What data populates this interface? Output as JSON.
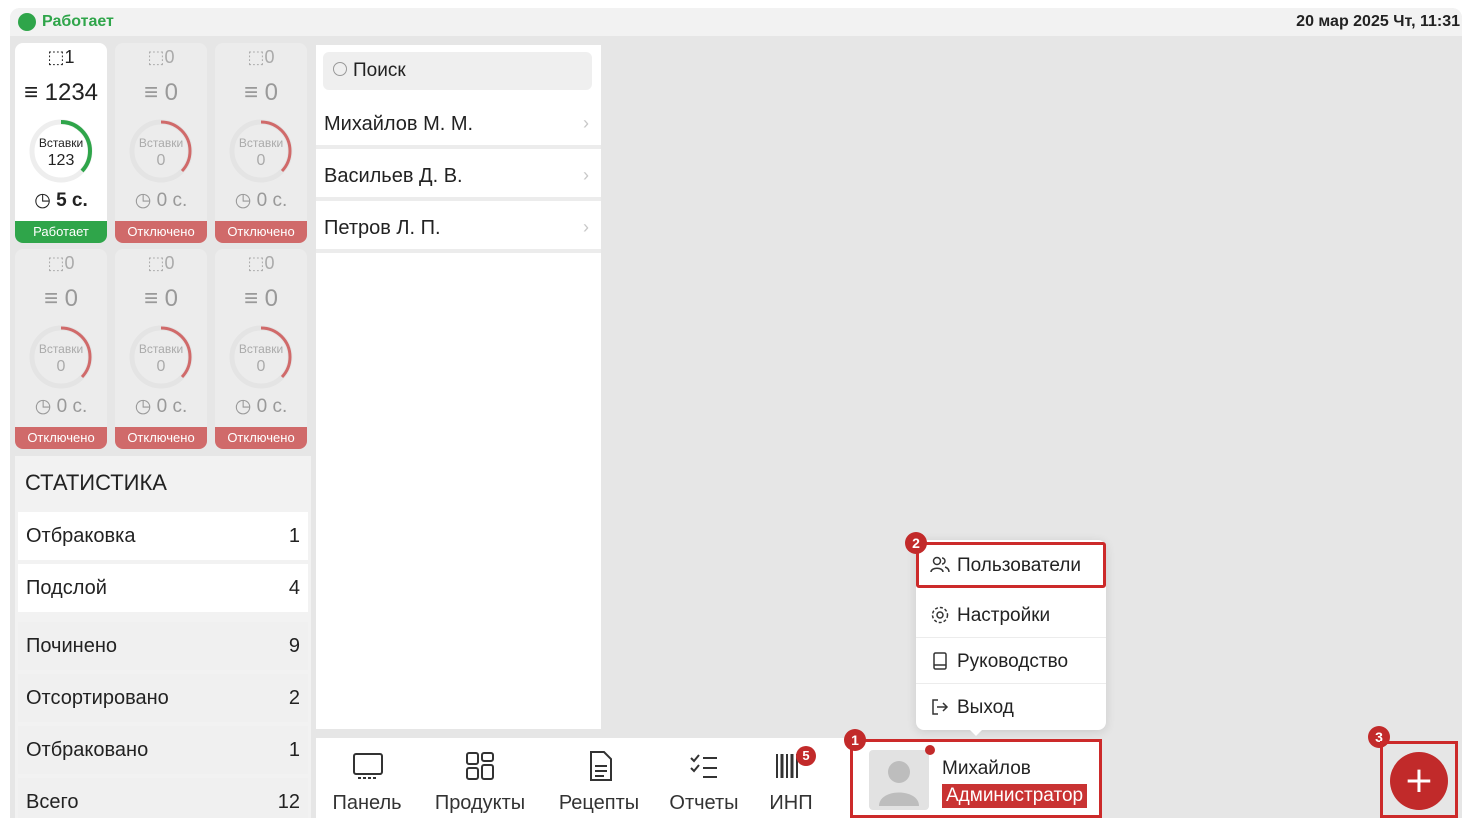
{
  "status": {
    "text": "Работает",
    "datetime": "20 мар 2025 Чт, 11:31",
    "color": "#2fa54a"
  },
  "stations": [
    {
      "top_count": "1",
      "layers": "1234",
      "inserts_label": "Вставки",
      "inserts": "123",
      "time": "5 с.",
      "state": "Работает",
      "progress": 0.35
    },
    {
      "top_count": "0",
      "layers": "0",
      "inserts_label": "Вставки",
      "inserts": "0",
      "time": "0 с.",
      "state": "Отключено",
      "progress": 0.35
    },
    {
      "top_count": "0",
      "layers": "0",
      "inserts_label": "Вставки",
      "inserts": "0",
      "time": "0 с.",
      "state": "Отключено",
      "progress": 0.35
    },
    {
      "top_count": "0",
      "layers": "0",
      "inserts_label": "Вставки",
      "inserts": "0",
      "time": "0 с.",
      "state": "Отключено",
      "progress": 0.35
    },
    {
      "top_count": "0",
      "layers": "0",
      "inserts_label": "Вставки",
      "inserts": "0",
      "time": "0 с.",
      "state": "Отключено",
      "progress": 0.35
    },
    {
      "top_count": "0",
      "layers": "0",
      "inserts_label": "Вставки",
      "inserts": "0",
      "time": "0 с.",
      "state": "Отключено",
      "progress": 0.35
    }
  ],
  "stats": {
    "title": "СТАТИСТИКА",
    "rows": [
      {
        "label": "Отбраковка",
        "value": "1"
      },
      {
        "label": "Подслой",
        "value": "4"
      },
      {
        "label": "Починено",
        "value": "9"
      },
      {
        "label": "Отсортировано",
        "value": "2"
      },
      {
        "label": "Отбраковано",
        "value": "1"
      },
      {
        "label": "Всего",
        "value": "12"
      }
    ]
  },
  "users": {
    "search_placeholder": "Поиск",
    "items": [
      "Михайлов М. М.",
      "Васильев Д. В.",
      "Петров Л. П."
    ]
  },
  "nav": {
    "items": [
      {
        "label": "Панель",
        "icon": "monitor-icon"
      },
      {
        "label": "Продукты",
        "icon": "grid-icon"
      },
      {
        "label": "Рецепты",
        "icon": "document-icon"
      },
      {
        "label": "Отчеты",
        "icon": "checklist-icon"
      },
      {
        "label": "ИНП",
        "icon": "barcode-icon",
        "badge": "5"
      }
    ]
  },
  "menu": {
    "items": [
      {
        "label": "Пользователи",
        "icon": "users-icon"
      },
      {
        "label": "Настройки",
        "icon": "gear-icon"
      },
      {
        "label": "Руководство",
        "icon": "book-icon"
      },
      {
        "label": "Выход",
        "icon": "logout-icon"
      }
    ]
  },
  "profile": {
    "name": "Михайлов",
    "role": "Администратор"
  },
  "steps": {
    "one": "1",
    "two": "2",
    "three": "3"
  },
  "fab": {
    "label": "+"
  },
  "colors": {
    "accent_red": "#c22a2a",
    "ok_green": "#2fa54a",
    "off_red": "#d06a6a"
  }
}
